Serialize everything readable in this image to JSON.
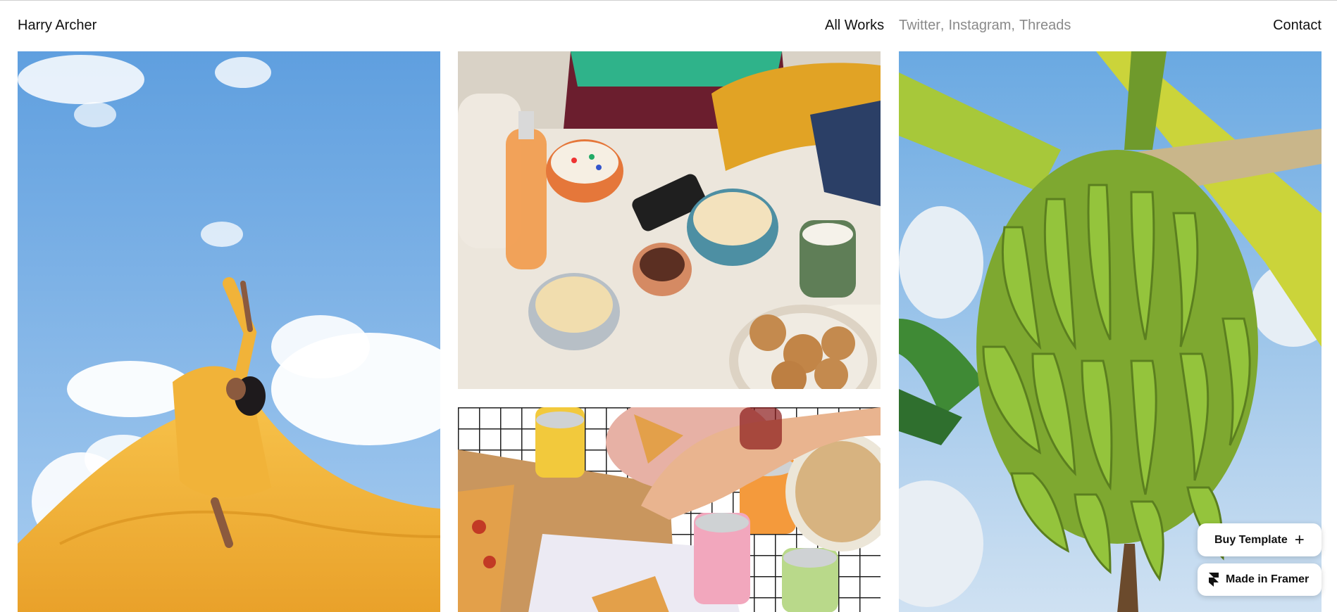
{
  "header": {
    "brand": "Harry Archer",
    "nav_all_works": "All Works",
    "socials": [
      {
        "label": "Twitter"
      },
      {
        "label": "Instagram"
      },
      {
        "label": "Threads"
      }
    ],
    "contact": "Contact"
  },
  "works": [
    {
      "subject": "woman in yellow dress against sky",
      "icon": "photo-dress"
    },
    {
      "subject": "popcorn and snacks table",
      "icon": "photo-popcorn"
    },
    {
      "subject": "pizza and cans table",
      "icon": "photo-pizza"
    },
    {
      "subject": "banana bunch against sky",
      "icon": "photo-banana"
    }
  ],
  "badges": {
    "buy_template": "Buy Template",
    "made_in_framer": "Made in Framer"
  },
  "colors": {
    "sky": "#8cbce6",
    "dress": "#f0b43a",
    "banana": "#8fbf3a",
    "text_muted": "#8a8a8a"
  }
}
